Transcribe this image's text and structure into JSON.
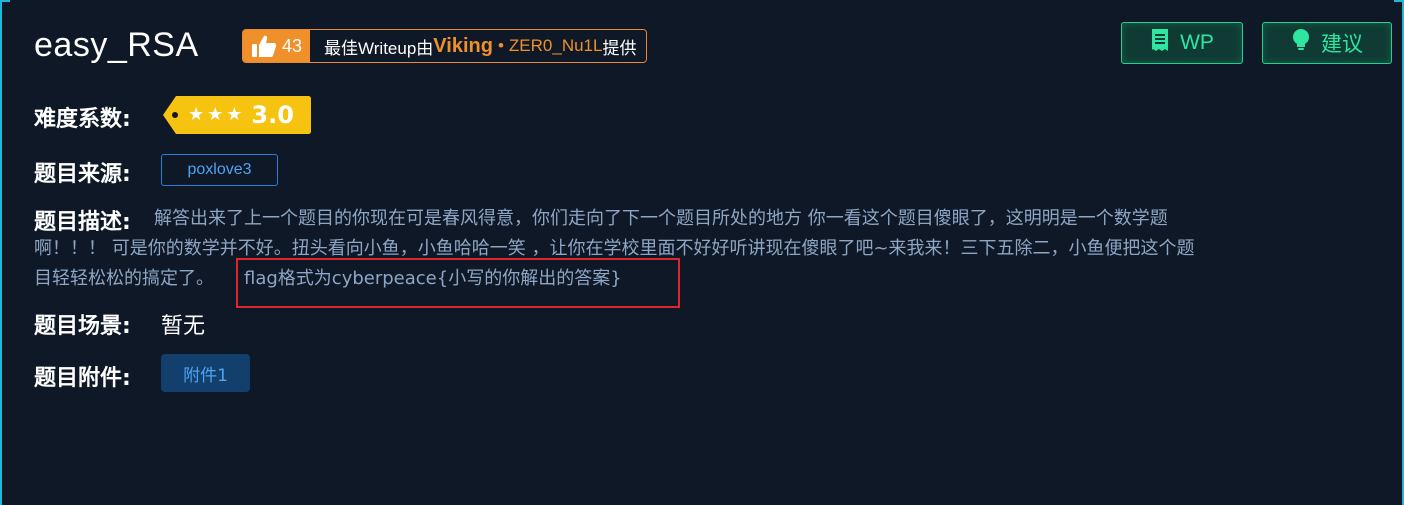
{
  "challenge": {
    "title": "easy_RSA"
  },
  "writeup_badge": {
    "likes": "43",
    "prefix": "最佳Writeup由",
    "author": "Viking",
    "separator": "•",
    "team": "ZER0_Nu1L",
    "suffix": "提供"
  },
  "actions": {
    "wp_label": "WP",
    "suggest_label": "建议"
  },
  "difficulty": {
    "label": "难度系数:",
    "stars": 3,
    "value": "3.0",
    "tag_color": "#f7c311"
  },
  "source": {
    "label": "题目来源:",
    "value": "poxlove3"
  },
  "description": {
    "label": "题目描述:",
    "line1": "解答出来了上一个题目的你现在可是春风得意，你们走向了下一个题目所处的地方 你一看这个题目傻眼了，这明明是一个数学题",
    "line2": "啊！！！ 可是你的数学并不好。扭头看向小鱼，小鱼哈哈一笑 ，让你在学校里面不好好听讲现在傻眼了吧~来我来！三下五除二，小鱼便把这个题",
    "line3": "目轻轻松松的搞定了。",
    "flag_hint": "flag格式为cyberpeace{小写的你解出的答案}"
  },
  "scene": {
    "label": "题目场景:",
    "value": "暂无"
  },
  "attachments": {
    "label": "题目附件:",
    "items": [
      "附件1"
    ]
  },
  "colors": {
    "background": "#0e1826",
    "accent_green": "#2ee6a0",
    "accent_orange": "#f0902b",
    "link_blue": "#4ea3f2",
    "highlight_red": "#e0262d"
  }
}
